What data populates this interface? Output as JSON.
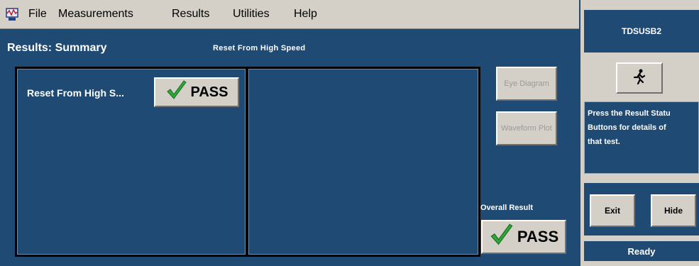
{
  "menu": {
    "app_icon": "oscilloscope-app-icon",
    "items": [
      "File",
      "Measurements",
      "Results",
      "Utilities",
      "Help"
    ]
  },
  "main": {
    "title": "Results: Summary",
    "subtitle": "Reset From High Speed",
    "results": [
      {
        "label": "Reset From High S...",
        "status": "PASS",
        "status_icon": "check-icon"
      }
    ],
    "buttons": {
      "eye_diagram": "Eye Diagram",
      "waveform_plot": "Waveform Plot"
    },
    "overall": {
      "label": "Overall Result",
      "status": "PASS",
      "status_icon": "check-icon"
    }
  },
  "right_panel": {
    "title": "TDSUSB2",
    "run_icon": "running-man-icon",
    "info_text": "Press the Result Status Buttons for details of that test.",
    "info_lines": [
      "Press the Result Statu",
      "Buttons for details of",
      "that test."
    ],
    "exit_label": "Exit",
    "hide_label": "Hide",
    "status": "Ready"
  },
  "colors": {
    "panel_blue": "#1f4a73",
    "chrome_gray": "#d4d0c8",
    "check_green": "#2fa83a"
  }
}
